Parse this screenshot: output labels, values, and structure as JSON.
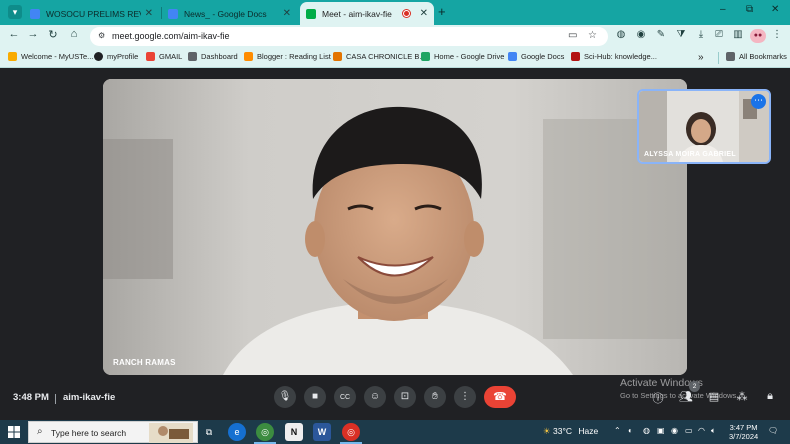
{
  "browser": {
    "tabs": [
      {
        "title": "WOSOCU PRELIMS REVIEWER",
        "favicon_color": "#4285f4",
        "active": false
      },
      {
        "title": "News_ - Google Docs",
        "favicon_color": "#4285f4",
        "active": false
      },
      {
        "title": "Meet - aim-ikav-fie",
        "favicon_color": "#00ac47",
        "active": true
      }
    ],
    "new_tab_label": "+",
    "window_controls": {
      "minimize": "–",
      "maximize": "⧉",
      "close": "✕"
    },
    "url": "meet.google.com/aim-ikav-fie",
    "profile_label": "●●"
  },
  "bookmarks": {
    "items": [
      {
        "label": "Welcome - MyUSTe...",
        "color": "#f9ab00"
      },
      {
        "label": "myProfile",
        "color": "#202124"
      },
      {
        "label": "GMAIL",
        "color": "#ea4335"
      },
      {
        "label": "Dashboard",
        "color": "#5f6368"
      },
      {
        "label": "Blogger : Reading List",
        "color": "#ff8c00"
      },
      {
        "label": "CASA CHRONICLE B...",
        "color": "#e37400"
      },
      {
        "label": "Home - Google Drive",
        "color": "#1fa463"
      },
      {
        "label": "Google Docs",
        "color": "#4285f4"
      },
      {
        "label": "Sci-Hub: knowledge...",
        "color": "#b31412"
      }
    ],
    "more_label": "»",
    "all_bookmarks_label": "All Bookmarks"
  },
  "meet": {
    "main_participant": "RANCH RAMAS",
    "pip_participant": "ALYSSA MOIRA GABRIEL",
    "time": "3:48 PM",
    "meeting_code": "aim-ikav-fie",
    "people_count": "2",
    "controls": [
      "mic-icon",
      "camera-icon",
      "captions-icon",
      "emoji-icon",
      "present-icon",
      "raise-hand-icon",
      "more-options-icon",
      "end-call-icon"
    ],
    "watermark_line1": "Activate Windows",
    "watermark_line2": "Go to Settings to activate Windows."
  },
  "taskbar": {
    "search_placeholder": "Type here to search",
    "weather_temp": "33°C",
    "weather_desc": "Haze",
    "time": "3:47 PM",
    "date": "3/7/2024"
  }
}
